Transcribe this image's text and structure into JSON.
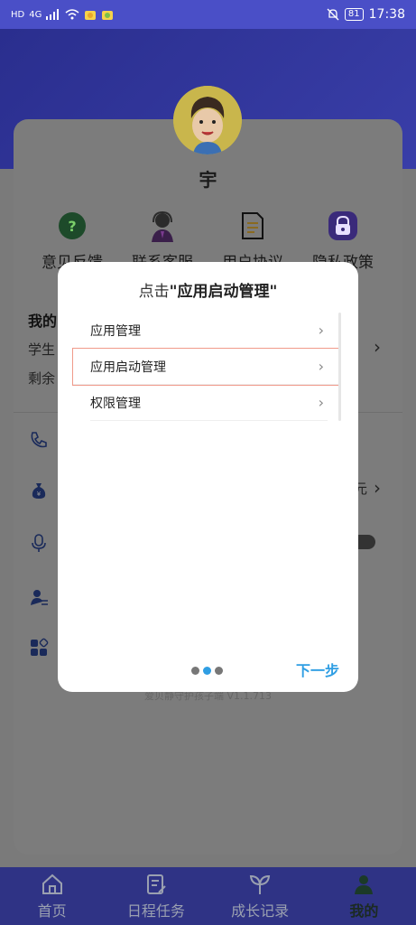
{
  "status_bar": {
    "left": [
      "HD",
      "4G"
    ],
    "battery": "81",
    "time": "17:38"
  },
  "profile": {
    "username": "宇"
  },
  "quick_actions": [
    {
      "label": "意见反馈",
      "icon": "feedback-icon"
    },
    {
      "label": "联系客服",
      "icon": "customer-service-icon"
    },
    {
      "label": "用户协议",
      "icon": "document-icon"
    },
    {
      "label": "隐私政策",
      "icon": "privacy-lock-icon"
    }
  ],
  "background_content": {
    "section_title": "我的",
    "line1": "学生",
    "line2": "剩余",
    "yuan": "元",
    "version": "爱贝静守护孩子端 V1.1.713"
  },
  "modal": {
    "title_prefix": "点击",
    "title_highlight": "\"应用启动管理\"",
    "items": [
      {
        "label": "应用管理"
      },
      {
        "label": "应用启动管理"
      },
      {
        "label": "权限管理"
      }
    ],
    "next_label": "下一步",
    "page_dots": 3,
    "active_dot": 1
  },
  "bottom_nav": [
    {
      "label": "首页",
      "icon": "home-icon"
    },
    {
      "label": "日程任务",
      "icon": "schedule-icon"
    },
    {
      "label": "成长记录",
      "icon": "sprout-icon"
    },
    {
      "label": "我的",
      "icon": "user-icon",
      "active": true
    }
  ],
  "colors": {
    "accent": "#2f9ee3",
    "highlight_border": "#f09a8a",
    "nav_bg": "#2f3385"
  }
}
